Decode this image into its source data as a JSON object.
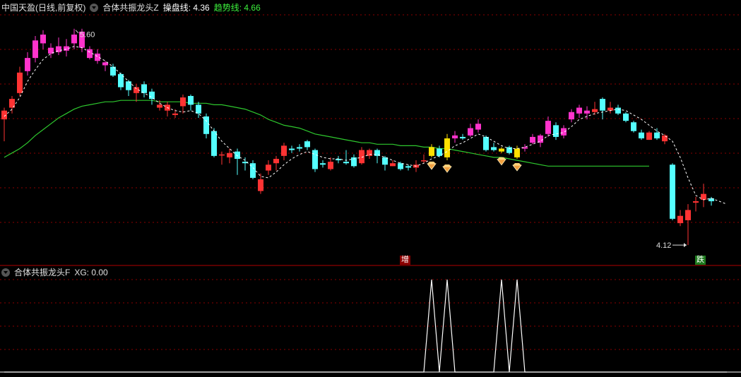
{
  "header_top": {
    "stock": "中国天盈",
    "period": "(日线,前复权)",
    "indicator": "合体共振龙头Z",
    "line1_label": "操盘线:",
    "line1_value": "4.36",
    "line2_label": "趋势线:",
    "line2_value": "4.66"
  },
  "header_bottom": {
    "indicator": "合体共振龙头F",
    "xg_label": "XG:",
    "xg_value": "0.00"
  },
  "markers": {
    "high_label": "5.60",
    "low_label": "4.12",
    "zeng": "增",
    "die": "跌"
  },
  "colors": {
    "up": "#ff3333",
    "down": "#54ffff",
    "magenta": "#ff33cc",
    "yellow": "#ffe000",
    "trend": "#2ec82e",
    "dashed": "#ffffff",
    "grid": "#8b0000"
  },
  "chart_data": [
    {
      "type": "candlestick",
      "price_range": [
        4.0,
        5.7
      ],
      "trend_line": [
        4.72,
        4.75,
        4.78,
        4.82,
        4.87,
        4.91,
        4.95,
        4.99,
        5.02,
        5.05,
        5.07,
        5.08,
        5.09,
        5.1,
        5.1,
        5.11,
        5.11,
        5.11,
        5.11,
        5.11,
        5.1,
        5.1,
        5.1,
        5.1,
        5.09,
        5.09,
        5.09,
        5.08,
        5.08,
        5.07,
        5.06,
        5.05,
        5.03,
        5.01,
        4.98,
        4.96,
        4.94,
        4.93,
        4.92,
        4.9,
        4.88,
        4.87,
        4.86,
        4.85,
        4.84,
        4.83,
        4.82,
        4.82,
        4.81,
        4.81,
        4.81,
        4.8,
        4.8,
        4.8,
        4.79,
        4.79,
        4.78,
        4.78,
        4.77,
        4.76,
        4.75,
        4.74,
        4.73,
        4.72,
        4.72,
        4.71,
        4.7,
        4.69,
        4.68,
        4.67,
        4.66,
        4.66,
        4.66,
        4.66,
        4.66,
        4.66,
        4.66,
        4.66,
        4.66,
        4.66,
        4.66,
        4.66,
        4.66,
        4.66
      ],
      "candles": [
        {
          "o": 4.98,
          "c": 5.04,
          "h": 5.06,
          "l": 4.83,
          "t": "up"
        },
        {
          "o": 5.06,
          "c": 5.12,
          "h": 5.14,
          "l": 5.02,
          "t": "up"
        },
        {
          "o": 5.16,
          "c": 5.3,
          "h": 5.34,
          "l": 5.14,
          "t": "up"
        },
        {
          "o": 5.31,
          "c": 5.4,
          "h": 5.44,
          "l": 5.28,
          "t": "magenta"
        },
        {
          "o": 5.4,
          "c": 5.52,
          "h": 5.55,
          "l": 5.37,
          "t": "magenta"
        },
        {
          "o": 5.5,
          "c": 5.56,
          "h": 5.59,
          "l": 5.46,
          "t": "magenta"
        },
        {
          "o": 5.47,
          "c": 5.43,
          "h": 5.5,
          "l": 5.4,
          "t": "magenta"
        },
        {
          "o": 5.48,
          "c": 5.44,
          "h": 5.54,
          "l": 5.42,
          "t": "magenta"
        },
        {
          "o": 5.45,
          "c": 5.48,
          "h": 5.53,
          "l": 5.41,
          "t": "magenta"
        },
        {
          "o": 5.56,
          "c": 5.5,
          "h": 5.6,
          "l": 5.46,
          "t": "magenta"
        },
        {
          "o": 5.58,
          "c": 5.47,
          "h": 5.6,
          "l": 5.44,
          "t": "magenta"
        },
        {
          "o": 5.46,
          "c": 5.4,
          "h": 5.48,
          "l": 5.39,
          "t": "magenta"
        },
        {
          "o": 5.43,
          "c": 5.38,
          "h": 5.46,
          "l": 5.36,
          "t": "magenta"
        },
        {
          "o": 5.37,
          "c": 5.35,
          "h": 5.38,
          "l": 5.31,
          "t": "magenta"
        },
        {
          "o": 5.34,
          "c": 5.28,
          "h": 5.36,
          "l": 5.27,
          "t": "down"
        },
        {
          "o": 5.29,
          "c": 5.2,
          "h": 5.3,
          "l": 5.18,
          "t": "down"
        },
        {
          "o": 5.24,
          "c": 5.18,
          "h": 5.25,
          "l": 5.14,
          "t": "down"
        },
        {
          "o": 5.2,
          "c": 5.16,
          "h": 5.22,
          "l": 5.1,
          "t": "up"
        },
        {
          "o": 5.22,
          "c": 5.16,
          "h": 5.24,
          "l": 5.13,
          "t": "down"
        },
        {
          "o": 5.17,
          "c": 5.12,
          "h": 5.19,
          "l": 5.08,
          "t": "down"
        },
        {
          "o": 5.08,
          "c": 5.06,
          "h": 5.11,
          "l": 5.04,
          "t": "up"
        },
        {
          "o": 5.08,
          "c": 5.04,
          "h": 5.1,
          "l": 5.0,
          "t": "up"
        },
        {
          "o": 5.02,
          "c": 5.01,
          "h": 5.05,
          "l": 4.99,
          "t": "up"
        },
        {
          "o": 5.07,
          "c": 5.13,
          "h": 5.15,
          "l": 5.02,
          "t": "up"
        },
        {
          "o": 5.14,
          "c": 5.08,
          "h": 5.15,
          "l": 5.04,
          "t": "down"
        },
        {
          "o": 5.08,
          "c": 5.02,
          "h": 5.1,
          "l": 4.99,
          "t": "down"
        },
        {
          "o": 5.0,
          "c": 4.88,
          "h": 5.02,
          "l": 4.85,
          "t": "down"
        },
        {
          "o": 4.9,
          "c": 4.73,
          "h": 4.92,
          "l": 4.72,
          "t": "down"
        },
        {
          "o": 4.74,
          "c": 4.74,
          "h": 4.76,
          "l": 4.67,
          "t": "up"
        },
        {
          "o": 4.72,
          "c": 4.75,
          "h": 4.78,
          "l": 4.68,
          "t": "up"
        },
        {
          "o": 4.76,
          "c": 4.71,
          "h": 4.78,
          "l": 4.6,
          "t": "down"
        },
        {
          "o": 4.69,
          "c": 4.68,
          "h": 4.72,
          "l": 4.63,
          "t": "down"
        },
        {
          "o": 4.58,
          "c": 4.68,
          "h": 4.7,
          "l": 4.57,
          "t": "down"
        },
        {
          "o": 4.57,
          "c": 4.49,
          "h": 4.61,
          "l": 4.47,
          "t": "up"
        },
        {
          "o": 4.63,
          "c": 4.67,
          "h": 4.7,
          "l": 4.6,
          "t": "up"
        },
        {
          "o": 4.68,
          "c": 4.71,
          "h": 4.73,
          "l": 4.63,
          "t": "up"
        },
        {
          "o": 4.73,
          "c": 4.8,
          "h": 4.82,
          "l": 4.7,
          "t": "up"
        },
        {
          "o": 4.77,
          "c": 4.78,
          "h": 4.8,
          "l": 4.75,
          "t": "down"
        },
        {
          "o": 4.78,
          "c": 4.79,
          "h": 4.81,
          "l": 4.76,
          "t": "down"
        },
        {
          "o": 4.79,
          "c": 4.83,
          "h": 4.84,
          "l": 4.77,
          "t": "down"
        },
        {
          "o": 4.77,
          "c": 4.64,
          "h": 4.78,
          "l": 4.62,
          "t": "down"
        },
        {
          "o": 4.67,
          "c": 4.68,
          "h": 4.7,
          "l": 4.65,
          "t": "down"
        },
        {
          "o": 4.64,
          "c": 4.69,
          "h": 4.72,
          "l": 4.63,
          "t": "up"
        },
        {
          "o": 4.71,
          "c": 4.7,
          "h": 4.73,
          "l": 4.68,
          "t": "down"
        },
        {
          "o": 4.69,
          "c": 4.68,
          "h": 4.77,
          "l": 4.67,
          "t": "down"
        },
        {
          "o": 4.66,
          "c": 4.72,
          "h": 4.74,
          "l": 4.65,
          "t": "down"
        },
        {
          "o": 4.68,
          "c": 4.77,
          "h": 4.79,
          "l": 4.67,
          "t": "up"
        },
        {
          "o": 4.73,
          "c": 4.77,
          "h": 4.78,
          "l": 4.71,
          "t": "up"
        },
        {
          "o": 4.77,
          "c": 4.73,
          "h": 4.78,
          "l": 4.68,
          "t": "down"
        },
        {
          "o": 4.72,
          "c": 4.67,
          "h": 4.73,
          "l": 4.63,
          "t": "down"
        },
        {
          "o": 4.66,
          "c": 4.68,
          "h": 4.7,
          "l": 4.66,
          "t": "up"
        },
        {
          "o": 4.68,
          "c": 4.64,
          "h": 4.69,
          "l": 4.63,
          "t": "down"
        },
        {
          "o": 4.65,
          "c": 4.66,
          "h": 4.67,
          "l": 4.63,
          "t": "down"
        },
        {
          "o": 4.67,
          "c": 4.65,
          "h": 4.7,
          "l": 4.62,
          "t": "up"
        },
        {
          "o": 4.7,
          "c": 4.7,
          "h": 4.74,
          "l": 4.68,
          "t": "up"
        },
        {
          "o": 4.73,
          "c": 4.79,
          "h": 4.81,
          "l": 4.72,
          "t": "yellow"
        },
        {
          "o": 4.78,
          "c": 4.73,
          "h": 4.8,
          "l": 4.72,
          "t": "down"
        },
        {
          "o": 4.72,
          "c": 4.85,
          "h": 4.88,
          "l": 4.7,
          "t": "yellow"
        },
        {
          "o": 4.87,
          "c": 4.85,
          "h": 4.9,
          "l": 4.82,
          "t": "magenta"
        },
        {
          "o": 4.86,
          "c": 4.85,
          "h": 4.88,
          "l": 4.84,
          "t": "down"
        },
        {
          "o": 4.87,
          "c": 4.92,
          "h": 4.95,
          "l": 4.86,
          "t": "magenta"
        },
        {
          "o": 4.91,
          "c": 4.95,
          "h": 4.98,
          "l": 4.89,
          "t": "magenta"
        },
        {
          "o": 4.86,
          "c": 4.77,
          "h": 4.87,
          "l": 4.76,
          "t": "down"
        },
        {
          "o": 4.79,
          "c": 4.77,
          "h": 4.82,
          "l": 4.76,
          "t": "down"
        },
        {
          "o": 4.78,
          "c": 4.76,
          "h": 4.79,
          "l": 4.75,
          "t": "yellow"
        },
        {
          "o": 4.79,
          "c": 4.75,
          "h": 4.8,
          "l": 4.74,
          "t": "down"
        },
        {
          "o": 4.72,
          "c": 4.78,
          "h": 4.8,
          "l": 4.71,
          "t": "yellow"
        },
        {
          "o": 4.79,
          "c": 4.78,
          "h": 4.81,
          "l": 4.76,
          "t": "magenta"
        },
        {
          "o": 4.82,
          "c": 4.86,
          "h": 4.88,
          "l": 4.81,
          "t": "magenta"
        },
        {
          "o": 4.82,
          "c": 4.87,
          "h": 4.88,
          "l": 4.79,
          "t": "magenta"
        },
        {
          "o": 4.88,
          "c": 4.97,
          "h": 5.0,
          "l": 4.86,
          "t": "magenta"
        },
        {
          "o": 4.94,
          "c": 4.86,
          "h": 4.96,
          "l": 4.84,
          "t": "down"
        },
        {
          "o": 4.87,
          "c": 4.92,
          "h": 4.94,
          "l": 4.85,
          "t": "magenta"
        },
        {
          "o": 4.98,
          "c": 5.03,
          "h": 5.05,
          "l": 4.96,
          "t": "magenta"
        },
        {
          "o": 5.02,
          "c": 5.06,
          "h": 5.08,
          "l": 4.99,
          "t": "magenta"
        },
        {
          "o": 5.04,
          "c": 5.02,
          "h": 5.07,
          "l": 4.98,
          "t": "magenta"
        },
        {
          "o": 5.03,
          "c": 5.05,
          "h": 5.1,
          "l": 5.01,
          "t": "up"
        },
        {
          "o": 5.12,
          "c": 5.04,
          "h": 5.13,
          "l": 4.98,
          "t": "down"
        },
        {
          "o": 5.04,
          "c": 5.06,
          "h": 5.1,
          "l": 5.02,
          "t": "up"
        },
        {
          "o": 5.06,
          "c": 5.02,
          "h": 5.08,
          "l": 5.01,
          "t": "down"
        },
        {
          "o": 5.02,
          "c": 4.97,
          "h": 5.03,
          "l": 4.96,
          "t": "down"
        },
        {
          "o": 4.96,
          "c": 4.9,
          "h": 4.97,
          "l": 4.89,
          "t": "down"
        },
        {
          "o": 4.89,
          "c": 4.85,
          "h": 4.91,
          "l": 4.84,
          "t": "down"
        },
        {
          "o": 4.89,
          "c": 4.84,
          "h": 4.9,
          "l": 4.84,
          "t": "up"
        },
        {
          "o": 4.85,
          "c": 4.89,
          "h": 4.92,
          "l": 4.84,
          "t": "down"
        },
        {
          "o": 4.87,
          "c": 4.83,
          "h": 4.88,
          "l": 4.81,
          "t": "up"
        },
        {
          "o": 4.67,
          "c": 4.3,
          "h": 4.68,
          "l": 4.29,
          "t": "down"
        },
        {
          "o": 4.32,
          "c": 4.27,
          "h": 4.36,
          "l": 4.25,
          "t": "up"
        },
        {
          "o": 4.29,
          "c": 4.36,
          "h": 4.4,
          "l": 4.12,
          "t": "up"
        },
        {
          "o": 4.42,
          "c": 4.41,
          "h": 4.45,
          "l": 4.35,
          "t": "up"
        },
        {
          "o": 4.47,
          "c": 4.43,
          "h": 4.54,
          "l": 4.38,
          "t": "up"
        },
        {
          "o": 4.44,
          "c": 4.42,
          "h": 4.45,
          "l": 4.39,
          "t": "down"
        }
      ],
      "operate_line": [
        5.0,
        5.05,
        5.13,
        5.24,
        5.32,
        5.39,
        5.43,
        5.45,
        5.46,
        5.48,
        5.47,
        5.44,
        5.41,
        5.38,
        5.34,
        5.29,
        5.24,
        5.19,
        5.16,
        5.13,
        5.09,
        5.06,
        5.04,
        5.03,
        5.04,
        5.02,
        4.97,
        4.9,
        4.83,
        4.78,
        4.73,
        4.7,
        4.65,
        4.59,
        4.58,
        4.62,
        4.67,
        4.71,
        4.74,
        4.76,
        4.74,
        4.72,
        4.71,
        4.71,
        4.7,
        4.71,
        4.72,
        4.74,
        4.74,
        4.72,
        4.7,
        4.68,
        4.67,
        4.66,
        4.68,
        4.71,
        4.73,
        4.76,
        4.8,
        4.82,
        4.85,
        4.88,
        4.86,
        4.83,
        4.8,
        4.78,
        4.78,
        4.79,
        4.81,
        4.83,
        4.87,
        4.88,
        4.89,
        4.93,
        4.98,
        5.0,
        5.02,
        5.03,
        5.04,
        5.05,
        5.04,
        5.01,
        4.98,
        4.94,
        4.9,
        4.87,
        4.83,
        4.72,
        4.58,
        4.46,
        4.43,
        4.44,
        4.42,
        4.4
      ]
    },
    {
      "type": "line",
      "name": "XG",
      "y_range": [
        0,
        1
      ],
      "values": [
        0,
        0,
        0,
        0,
        0,
        0,
        0,
        0,
        0,
        0,
        0,
        0,
        0,
        0,
        0,
        0,
        0,
        0,
        0,
        0,
        0,
        0,
        0,
        0,
        0,
        0,
        0,
        0,
        0,
        0,
        0,
        0,
        0,
        0,
        0,
        0,
        0,
        0,
        0,
        0,
        0,
        0,
        0,
        0,
        0,
        0,
        0,
        0,
        0,
        0,
        0,
        0,
        0,
        0,
        0,
        1,
        0,
        1,
        0,
        0,
        0,
        0,
        0,
        0,
        1,
        0,
        1,
        0,
        0,
        0,
        0,
        0,
        0,
        0,
        0,
        0,
        0,
        0,
        0,
        0,
        0,
        0,
        0,
        0,
        0,
        0,
        0,
        0,
        0,
        0,
        0,
        0,
        0,
        0
      ]
    }
  ]
}
